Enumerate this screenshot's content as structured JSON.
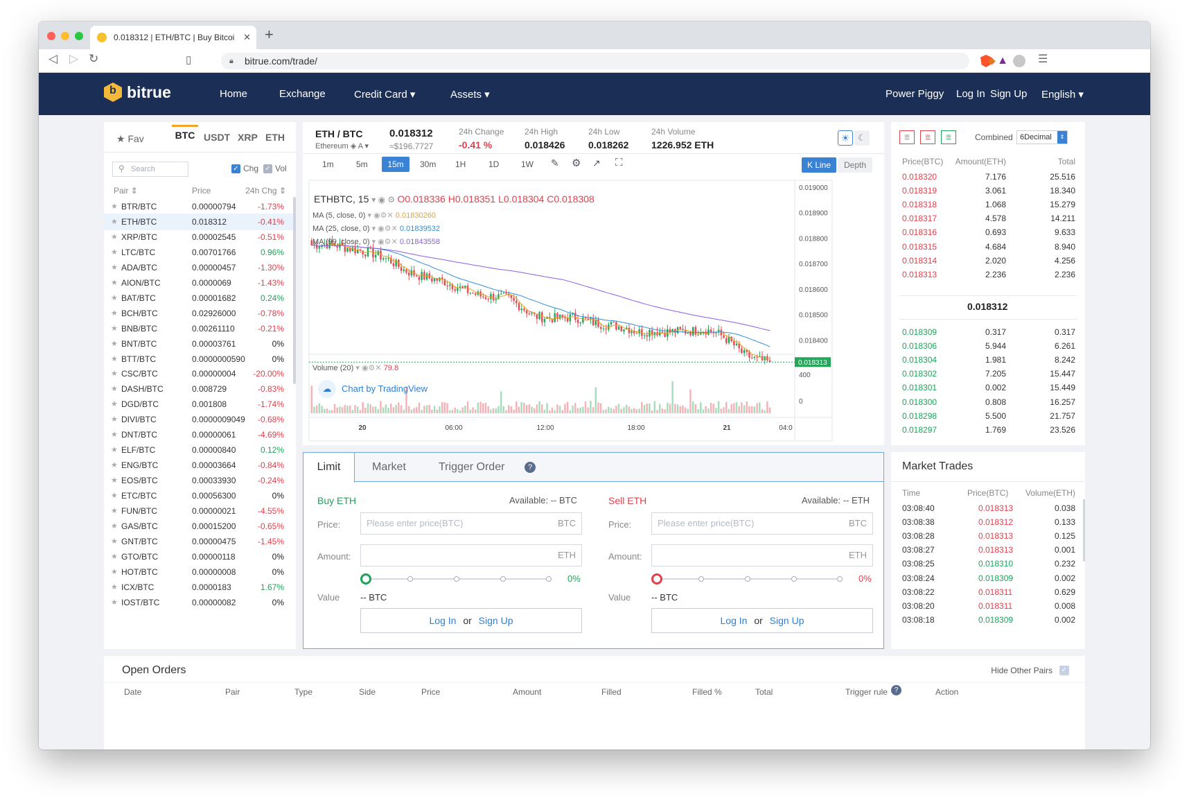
{
  "browser": {
    "tab_title": "0.018312 | ETH/BTC | Buy Bitcoi",
    "url": "bitrue.com/trade/"
  },
  "nav": {
    "brand": "bitrue",
    "home": "Home",
    "exchange": "Exchange",
    "credit_card": "Credit Card ▾",
    "assets": "Assets ▾",
    "power_piggy": "Power Piggy",
    "login": "Log In",
    "signup": "Sign Up",
    "language": "English ▾"
  },
  "pairs": {
    "tabs": [
      "★ Fav",
      "BTC",
      "USDT",
      "XRP",
      "ETH"
    ],
    "search_placeholder": "Search",
    "chg_label": "Chg",
    "vol_label": "Vol",
    "headers": [
      "Pair ⇕",
      "Price",
      "24h Chg ⇕"
    ],
    "rows": [
      {
        "pair": "BTR/BTC",
        "price": "0.00000794",
        "change": "-1.73%",
        "color": "red"
      },
      {
        "pair": "ETH/BTC",
        "price": "0.018312",
        "change": "-0.41%",
        "color": "red"
      },
      {
        "pair": "XRP/BTC",
        "price": "0.00002545",
        "change": "-0.51%",
        "color": "red"
      },
      {
        "pair": "LTC/BTC",
        "price": "0.00701766",
        "change": "0.96%",
        "color": "green"
      },
      {
        "pair": "ADA/BTC",
        "price": "0.00000457",
        "change": "-1.30%",
        "color": "red"
      },
      {
        "pair": "AION/BTC",
        "price": "0.0000069",
        "change": "-1.43%",
        "color": "red"
      },
      {
        "pair": "BAT/BTC",
        "price": "0.00001682",
        "change": "0.24%",
        "color": "green"
      },
      {
        "pair": "BCH/BTC",
        "price": "0.02926000",
        "change": "-0.78%",
        "color": "red"
      },
      {
        "pair": "BNB/BTC",
        "price": "0.00261110",
        "change": "-0.21%",
        "color": "red"
      },
      {
        "pair": "BNT/BTC",
        "price": "0.00003761",
        "change": "0%",
        "color": "black"
      },
      {
        "pair": "BTT/BTC",
        "price": "0.0000000590",
        "change": "0%",
        "color": "black"
      },
      {
        "pair": "CSC/BTC",
        "price": "0.00000004",
        "change": "-20.00%",
        "color": "red"
      },
      {
        "pair": "DASH/BTC",
        "price": "0.008729",
        "change": "-0.83%",
        "color": "red"
      },
      {
        "pair": "DGD/BTC",
        "price": "0.001808",
        "change": "-1.74%",
        "color": "red"
      },
      {
        "pair": "DIVI/BTC",
        "price": "0.0000009049",
        "change": "-0.68%",
        "color": "red"
      },
      {
        "pair": "DNT/BTC",
        "price": "0.00000061",
        "change": "-4.69%",
        "color": "red"
      },
      {
        "pair": "ELF/BTC",
        "price": "0.00000840",
        "change": "0.12%",
        "color": "green"
      },
      {
        "pair": "ENG/BTC",
        "price": "0.00003664",
        "change": "-0.84%",
        "color": "red"
      },
      {
        "pair": "EOS/BTC",
        "price": "0.00033930",
        "change": "-0.24%",
        "color": "red"
      },
      {
        "pair": "ETC/BTC",
        "price": "0.00056300",
        "change": "0%",
        "color": "black"
      },
      {
        "pair": "FUN/BTC",
        "price": "0.00000021",
        "change": "-4.55%",
        "color": "red"
      },
      {
        "pair": "GAS/BTC",
        "price": "0.00015200",
        "change": "-0.65%",
        "color": "red"
      },
      {
        "pair": "GNT/BTC",
        "price": "0.00000475",
        "change": "-1.45%",
        "color": "red"
      },
      {
        "pair": "GTO/BTC",
        "price": "0.00000118",
        "change": "0%",
        "color": "black"
      },
      {
        "pair": "HOT/BTC",
        "price": "0.00000008",
        "change": "0%",
        "color": "black"
      },
      {
        "pair": "ICX/BTC",
        "price": "0.0000183",
        "change": "1.67%",
        "color": "green"
      },
      {
        "pair": "IOST/BTC",
        "price": "0.00000082",
        "change": "0%",
        "color": "black"
      }
    ]
  },
  "ticker": {
    "pair": "ETH / BTC",
    "name": "Ethereum",
    "price": "0.018312",
    "price_usd": "≈$196.7727",
    "change_label": "24h Change",
    "change": "-0.41 %",
    "high_label": "24h High",
    "high": "0.018426",
    "low_label": "24h Low",
    "low": "0.018262",
    "volume_label": "24h Volume",
    "volume": "1226.952 ETH"
  },
  "chart_tools": {
    "intervals": [
      "1m",
      "5m",
      "15m",
      "30m",
      "1H",
      "1D",
      "1W"
    ],
    "kline": "K Line",
    "depth": "Depth"
  },
  "chart_data": {
    "type": "candlestick",
    "symbol": "ETHBTC, 15",
    "ohlc_text": {
      "o": "0.018336",
      "h": "0.018351",
      "l": "0.018304",
      "c": "0.018308"
    },
    "indicators": [
      {
        "name": "MA (5, close, 0)",
        "value": "0.01830260",
        "color": "#e8a31a"
      },
      {
        "name": "MA (25, close, 0)",
        "value": "0.01839532",
        "color": "#2f8fd6"
      },
      {
        "name": "MA (99, close, 0)",
        "value": "0.01843558",
        "color": "#8e5ce6"
      }
    ],
    "y_ticks": [
      "0.019000",
      "0.018900",
      "0.018800",
      "0.018700",
      "0.018600",
      "0.018500",
      "0.018400"
    ],
    "ylim": [
      0.01833,
      0.019
    ],
    "last_price": "0.018313",
    "volume_label": "Volume (20)",
    "volume_value": "79.8",
    "volume_ticks": [
      "400",
      "0"
    ],
    "x_ticks": [
      "20",
      "06:00",
      "12:00",
      "18:00",
      "21",
      "04:0"
    ],
    "attribution": "Chart by TradingView",
    "close_path": [
      0.018772,
      0.018778,
      0.018771,
      0.018758,
      0.018748,
      0.018735,
      0.018712,
      0.018676,
      0.018655,
      0.018643,
      0.018632,
      0.01861,
      0.01859,
      0.018571,
      0.018571,
      0.018563,
      0.018531,
      0.018493,
      0.018487,
      0.018484,
      0.018491,
      0.018475,
      0.018463,
      0.018457,
      0.018449,
      0.01843,
      0.018435,
      0.018432,
      0.018434,
      0.018435,
      0.018441,
      0.018427,
      0.018392,
      0.018343,
      0.018322,
      0.018313
    ]
  },
  "orderbook": {
    "combined_label": "Combined",
    "decimal": "6Decimal",
    "headers": [
      "Price(BTC)",
      "Amount(ETH)",
      "Total"
    ],
    "asks": [
      [
        "0.018320",
        "7.176",
        "25.516"
      ],
      [
        "0.018319",
        "3.061",
        "18.340"
      ],
      [
        "0.018318",
        "1.068",
        "15.279"
      ],
      [
        "0.018317",
        "4.578",
        "14.211"
      ],
      [
        "0.018316",
        "0.693",
        "9.633"
      ],
      [
        "0.018315",
        "4.684",
        "8.940"
      ],
      [
        "0.018314",
        "2.020",
        "4.256"
      ],
      [
        "0.018313",
        "2.236",
        "2.236"
      ]
    ],
    "last": "0.018312",
    "bids": [
      [
        "0.018309",
        "0.317",
        "0.317"
      ],
      [
        "0.018306",
        "5.944",
        "6.261"
      ],
      [
        "0.018304",
        "1.981",
        "8.242"
      ],
      [
        "0.018302",
        "7.205",
        "15.447"
      ],
      [
        "0.018301",
        "0.002",
        "15.449"
      ],
      [
        "0.018300",
        "0.808",
        "16.257"
      ],
      [
        "0.018298",
        "5.500",
        "21.757"
      ],
      [
        "0.018297",
        "1.769",
        "23.526"
      ]
    ]
  },
  "order_form": {
    "tabs": [
      "Limit",
      "Market",
      "Trigger Order"
    ],
    "buy": {
      "title": "Buy ETH",
      "available": "Available: -- BTC",
      "price_label": "Price:",
      "price_placeholder": "Please enter price(BTC)",
      "price_unit": "BTC",
      "amount_label": "Amount:",
      "amount_unit": "ETH",
      "percent": "0%",
      "value_label": "Value",
      "value": "-- BTC",
      "login": "Log In",
      "or": "or",
      "signup": "Sign Up"
    },
    "sell": {
      "title": "Sell ETH",
      "available": "Available: -- ETH",
      "price_label": "Price:",
      "price_placeholder": "Please enter price(BTC)",
      "price_unit": "BTC",
      "amount_label": "Amount:",
      "amount_unit": "ETH",
      "percent": "0%",
      "value_label": "Value",
      "value": "-- BTC",
      "login": "Log In",
      "or": "or",
      "signup": "Sign Up"
    }
  },
  "market_trades": {
    "title": "Market Trades",
    "headers": [
      "Time",
      "Price(BTC)",
      "Volume(ETH)"
    ],
    "rows": [
      [
        "03:08:40",
        "0.018313",
        "0.038",
        "red"
      ],
      [
        "03:08:38",
        "0.018312",
        "0.133",
        "red"
      ],
      [
        "03:08:28",
        "0.018313",
        "0.125",
        "red"
      ],
      [
        "03:08:27",
        "0.018313",
        "0.001",
        "red"
      ],
      [
        "03:08:25",
        "0.018310",
        "0.232",
        "green"
      ],
      [
        "03:08:24",
        "0.018309",
        "0.002",
        "green"
      ],
      [
        "03:08:22",
        "0.018311",
        "0.629",
        "red"
      ],
      [
        "03:08:20",
        "0.018311",
        "0.008",
        "red"
      ],
      [
        "03:08:18",
        "0.018309",
        "0.002",
        "green"
      ]
    ]
  },
  "open_orders": {
    "title": "Open Orders",
    "hide_other_pairs": "Hide Other Pairs",
    "headers": [
      "Date",
      "Pair",
      "Type",
      "Side",
      "Price",
      "Amount",
      "Filled",
      "Filled %",
      "Total",
      "Trigger rule",
      "Action"
    ]
  }
}
